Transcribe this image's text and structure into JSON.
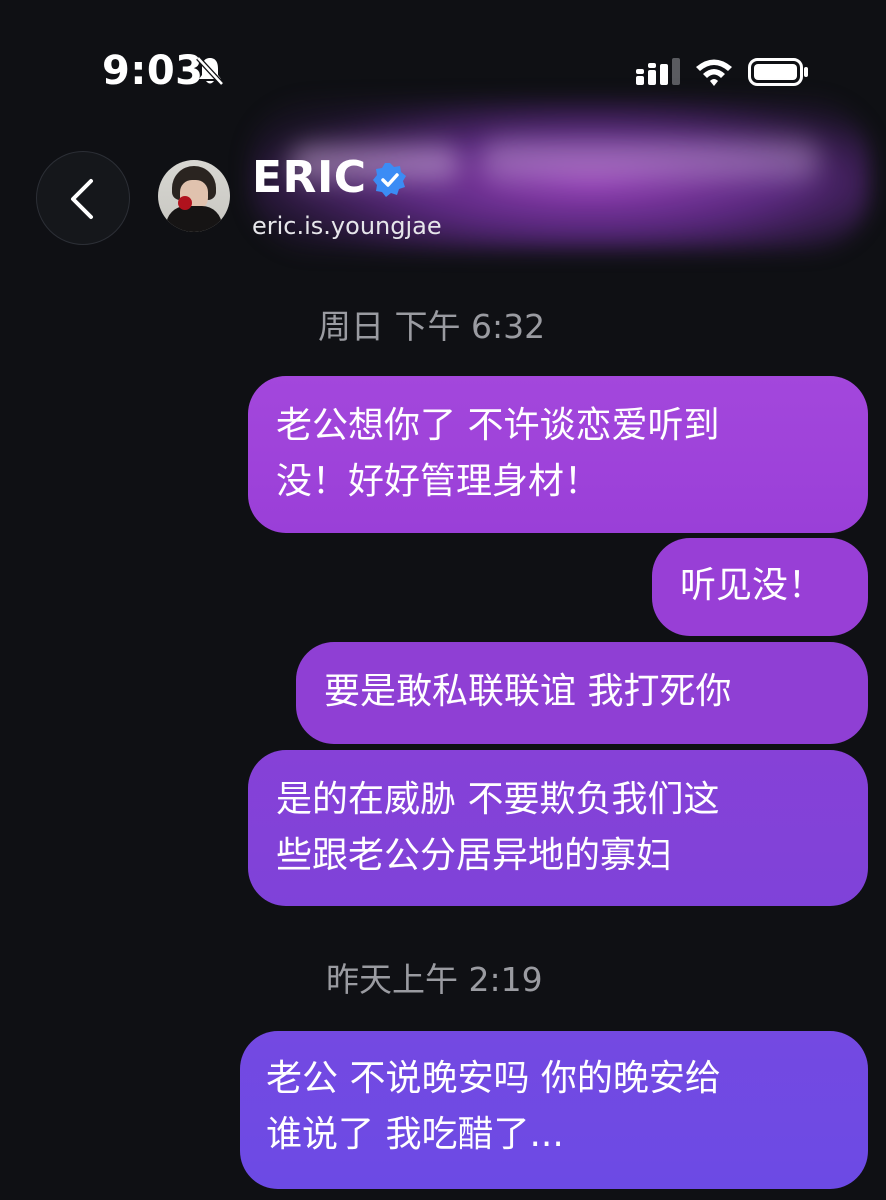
{
  "status_bar": {
    "time": "9:03"
  },
  "header": {
    "contact_name": "ERIC",
    "handle": "eric.is.youngjae"
  },
  "messages": [
    {
      "timestamp": "周日 下午 6:32",
      "bubbles": [
        {
          "lines": [
            "老公想你了 不许谈恋爱听到",
            "没！好好管理身材！"
          ]
        },
        {
          "lines": [
            "听见没！"
          ]
        },
        {
          "lines": [
            "要是敢私联联谊 我打死你"
          ]
        },
        {
          "lines": [
            "是的在威胁 不要欺负我们这",
            "些跟老公分居异地的寡妇"
          ]
        }
      ]
    },
    {
      "timestamp": "昨天上午 2:19",
      "bubbles": [
        {
          "lines": [
            "老公 不说晚安吗 你的晚安给",
            "谁说了 我吃醋了..."
          ]
        }
      ]
    }
  ],
  "icons": {
    "back": "chevron-left-icon",
    "mute": "bell-off-icon",
    "signal": "signal-icon",
    "wifi": "wifi-icon",
    "battery": "battery-icon",
    "verified": "verified-badge-icon"
  },
  "colors": {
    "background": "#0f1014",
    "bubble_top": "#a347dc",
    "bubble_bottom": "#6c4ae4",
    "verified_blue": "#3b8cf5",
    "timestamp_gray": "#9a9ba1"
  }
}
